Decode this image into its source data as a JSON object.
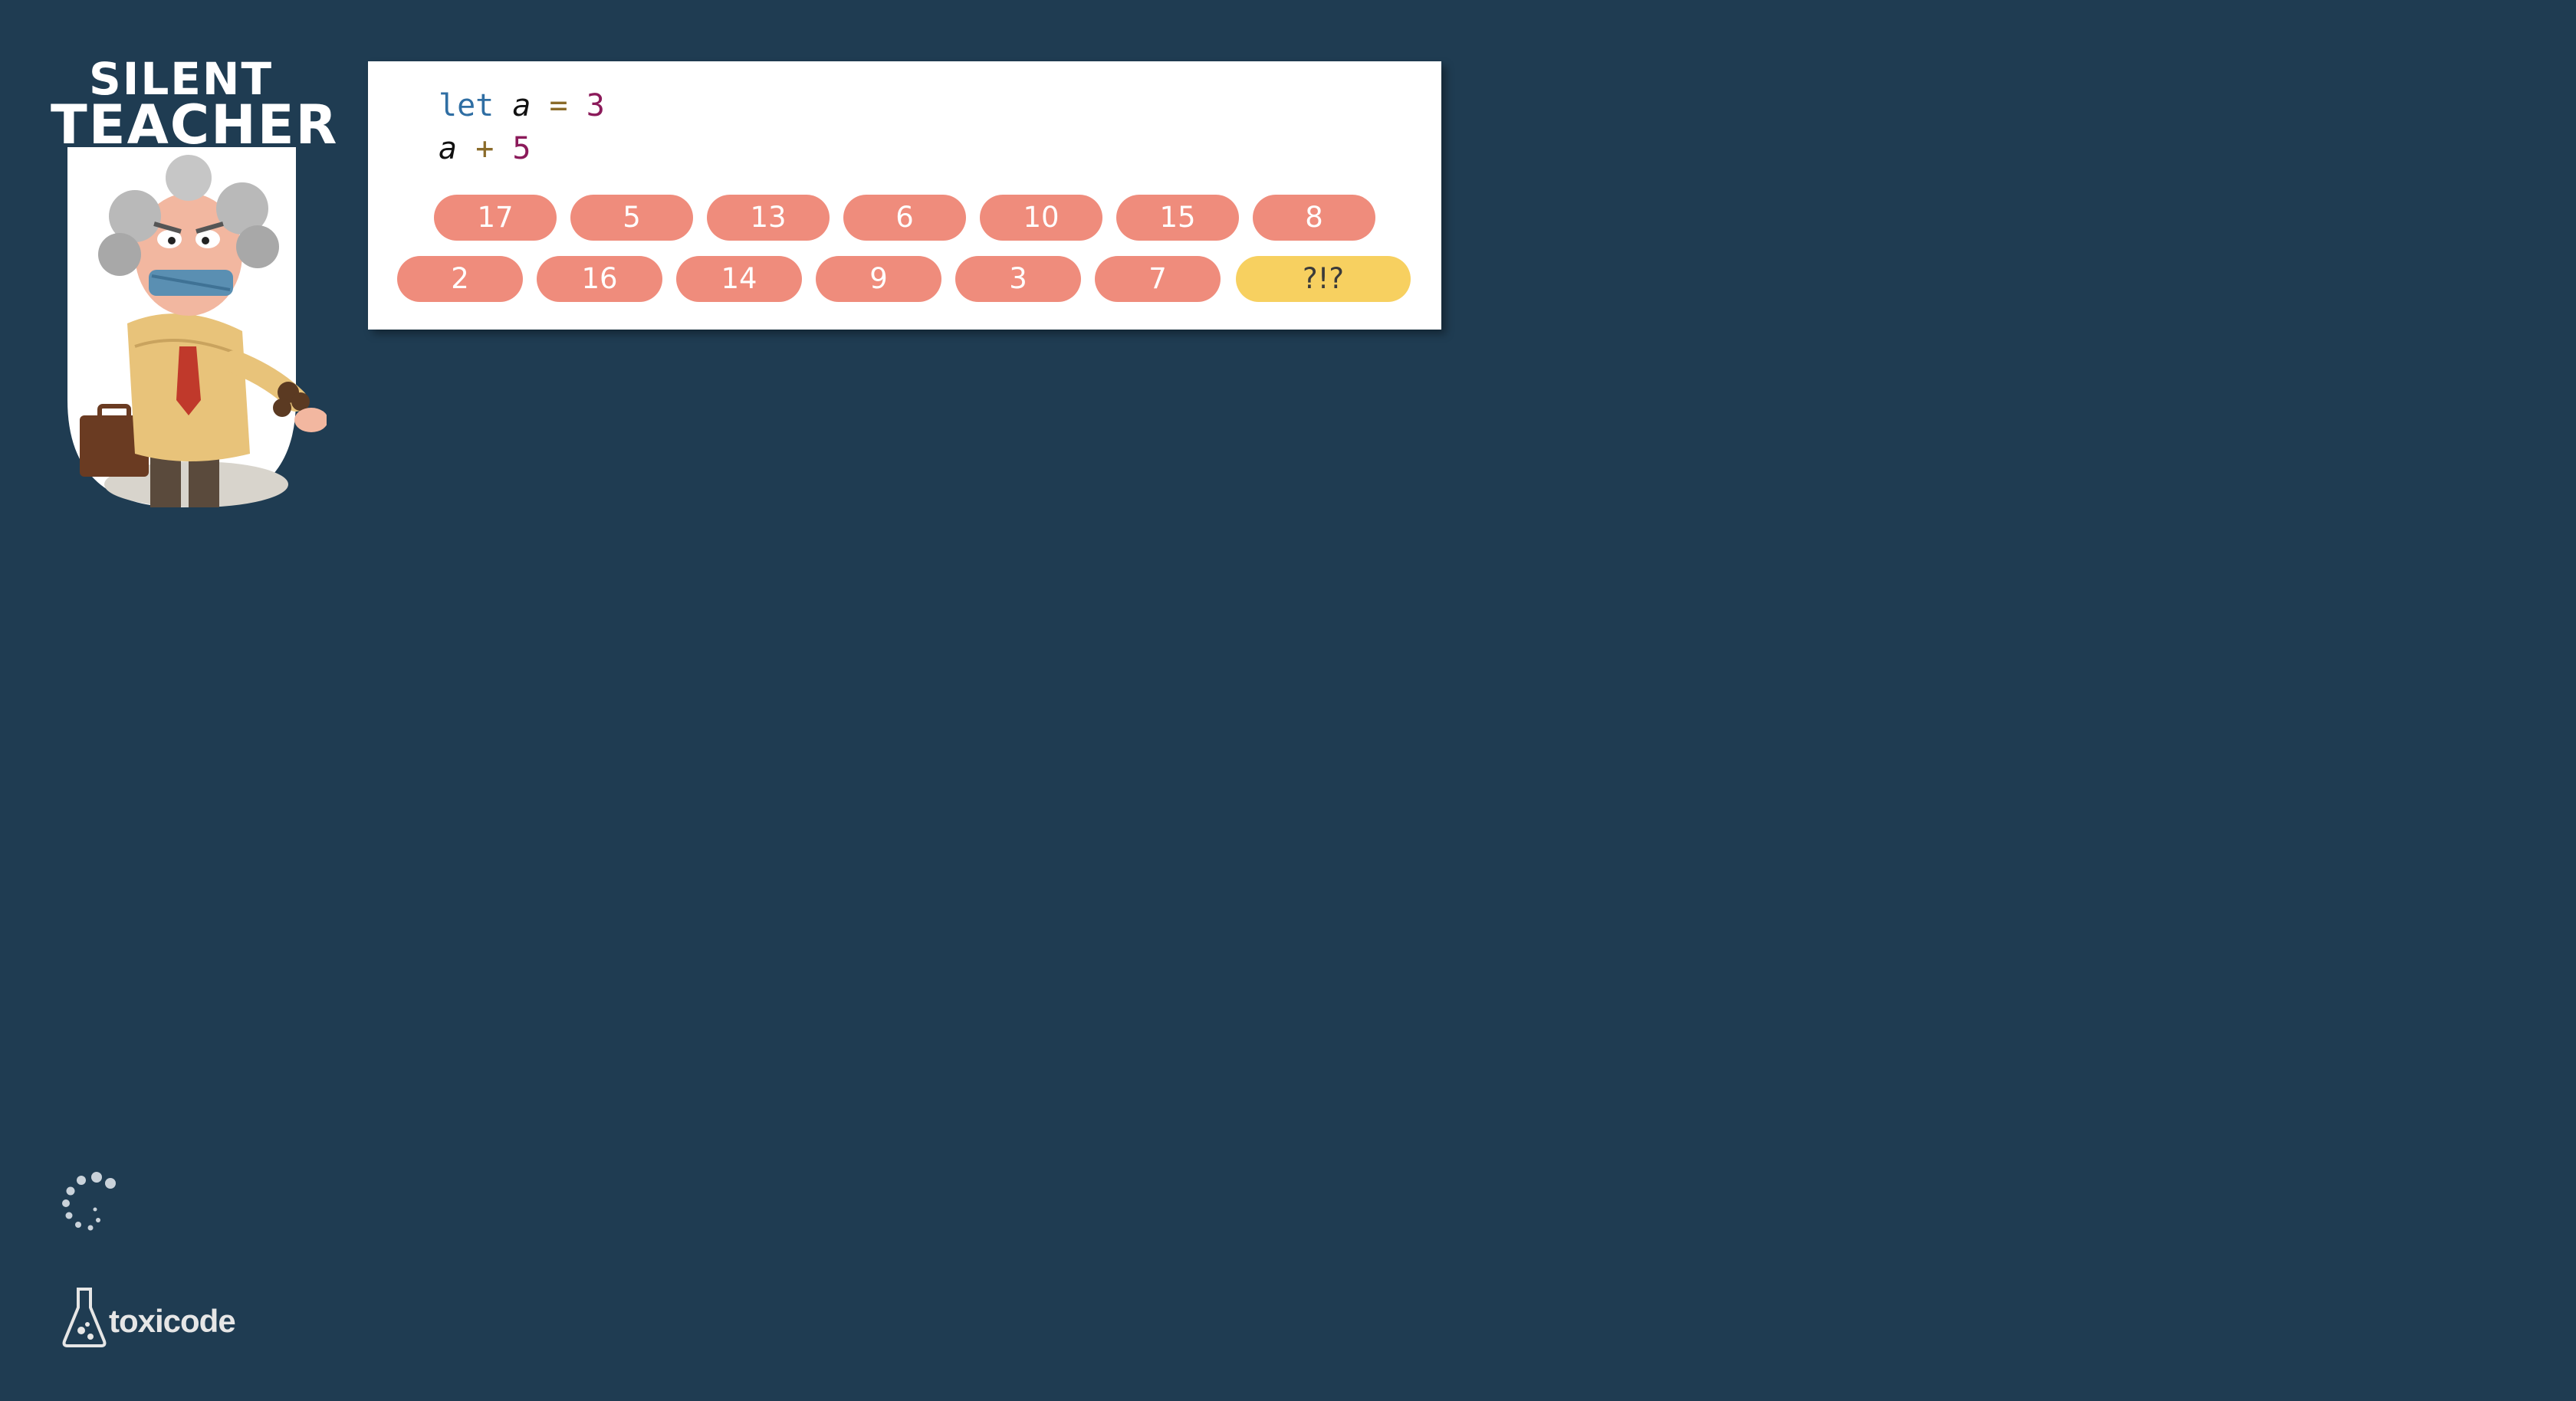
{
  "logo": {
    "line1": "SILENT",
    "line2": "TEACHER"
  },
  "code": {
    "line1": {
      "keyword": "let",
      "var": "a",
      "op": "=",
      "num": "3"
    },
    "line2": {
      "var": "a",
      "op": "+",
      "num": "5"
    }
  },
  "answers": {
    "row1": [
      "17",
      "5",
      "13",
      "6",
      "10",
      "15",
      "8"
    ],
    "row2": [
      "2",
      "16",
      "14",
      "9",
      "3",
      "7"
    ],
    "give_up": "?!?"
  },
  "footer": {
    "brand": "toxicode"
  },
  "colors": {
    "background": "#1f3c52",
    "answer_button": "#ef8c7c",
    "give_up_button": "#f7d060",
    "card": "#ffffff"
  },
  "icons": {
    "loading": "spinner-icon",
    "brand": "flask-icon"
  }
}
